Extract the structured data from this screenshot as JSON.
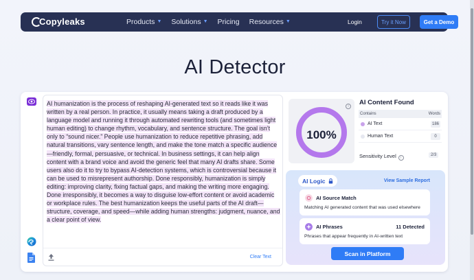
{
  "nav": {
    "logo_text": "Copyleaks",
    "links": [
      {
        "label": "Products",
        "dropdown": true
      },
      {
        "label": "Solutions",
        "dropdown": true
      },
      {
        "label": "Pricing",
        "dropdown": false
      },
      {
        "label": "Resources",
        "dropdown": true
      }
    ],
    "login": "Login",
    "try_now": "Try it Now",
    "get_demo": "Get a Demo"
  },
  "page_title": "AI Detector",
  "editor": {
    "text_segments": [
      "AI humanization is the process of reshaping AI-generated text so it reads like it was written by a real person. In practice, it usually means taking a draft produced by a language model and running it through automated rewriting tools (and sometimes light human editing) to change rhythm, vocabulary, and sentence structure. The goal isn’t only to “sound nicer.” People use humanization to reduce repetitive phrasing, add natural transitions, vary sentence length, and make the tone match a specific audience—friendly, formal, persuasive, or technical. In business settings, it can help align content with a brand voice and avoid the generic feel that many AI drafts share. Some users also do it to try to bypass AI-detection systems, which is controversial because it can be used to misrepresent authorship. Done responsibly, humanization is simply editing: improving clarity, fixing factual gaps, and making the writing more engaging. Done irresponsibly, it becomes a way to disguise low-effort content or avoid academic or workplace rules. The best humanization keeps the useful parts of the AI draft—structure, coverage, and speed—while adding human strengths: judgment, nuance, and a clear point of view."
    ],
    "clear_text": "Clear Text",
    "icons": [
      "eye-icon",
      "edge-browser-icon",
      "google-docs-icon",
      "upload-icon"
    ]
  },
  "result": {
    "percent": "100%",
    "percent_value": 100,
    "ai_content_title": "AI Content Found",
    "table_headers": {
      "contains": "Contains",
      "words": "Words"
    },
    "rows": [
      {
        "label": "AI Text",
        "count": "186",
        "color": "#c9a2ea"
      },
      {
        "label": "Human Text",
        "count": "0",
        "color": "#e6e8f0"
      }
    ],
    "sensitivity_label": "Sensitivity Level",
    "sensitivity_value": "2/3",
    "gauge_color": "#b478ec"
  },
  "ai_logic": {
    "title": "AI Logic",
    "view_sample": "View Sample Report",
    "cards": [
      {
        "title": "AI Source Match",
        "desc": "Matching AI generated content that was used elsewhere",
        "count": "",
        "icon_color": "#f3d3e0"
      },
      {
        "title": "AI Phrases",
        "desc": "Phrases that appear frequently in AI-written text",
        "count": "11 Detected",
        "icon_color": "#a77ce8"
      }
    ],
    "scan_button": "Scan in Platform"
  },
  "colors": {
    "nav_bg": "#283154",
    "accent": "#2f7cf6",
    "highlight": "#f3e4f8"
  }
}
